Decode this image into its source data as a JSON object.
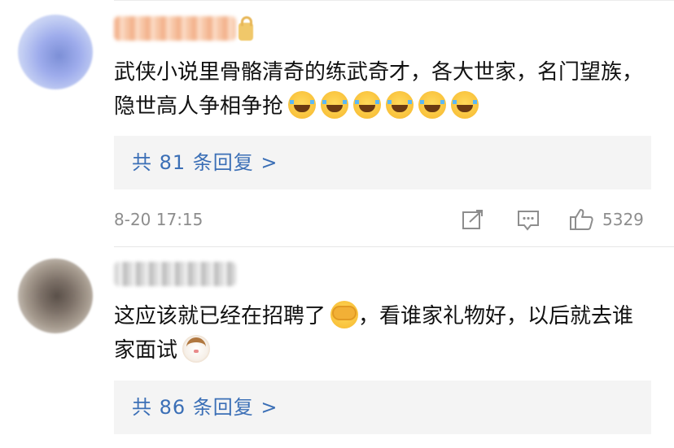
{
  "comments": [
    {
      "text_part1": "武侠小说里骨骼清奇的练武奇才，各大世家，名门望族，隐世高人争相争抢",
      "emojis": [
        "laughing-tears",
        "laughing-tears",
        "laughing-tears",
        "laughing-tears",
        "laughing-tears",
        "laughing-tears"
      ],
      "reply_link": "共 81 条回复 >",
      "timestamp": "8-20 17:15",
      "like_count": "5329"
    },
    {
      "text_part1": "这应该就已经在招聘了",
      "text_part2": "，看谁家礼物好，以后就去谁家面试",
      "emoji_inline": "face-covering",
      "emoji_end": "cat-face",
      "reply_link": "共 86 条回复 >"
    }
  ],
  "colors": {
    "link": "#3b6fb6",
    "meta": "#8d8d8d",
    "reply_bg": "#f4f4f4"
  }
}
